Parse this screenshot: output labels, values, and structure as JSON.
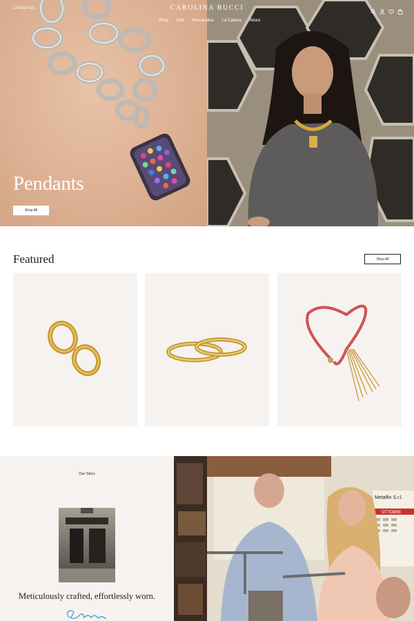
{
  "header": {
    "contact_label": "Contact Us",
    "brand": "CAROLINA BUCCI",
    "nav": [
      "Shop",
      "Edit",
      "Personalise",
      "La Catena",
      "About"
    ],
    "utility_icons": [
      "search-icon",
      "account-icon",
      "wishlist-heart-icon",
      "bag-icon"
    ]
  },
  "hero": {
    "title": "Pendants",
    "button_label": "Shop All"
  },
  "featured": {
    "title": "Featured",
    "button_label": "Shop All",
    "products": [
      {
        "name": "gold pave hoop earrings"
      },
      {
        "name": "gold pave stacking rings"
      },
      {
        "name": "red beaded necklace with gold tassel"
      }
    ]
  },
  "story": {
    "label": "Our Story",
    "heading": "Meticulously crafted, effortlessly worn.",
    "calendar": {
      "brand": "Metalfin S.r.l.",
      "month": "OTTOBRE"
    }
  },
  "colors": {
    "hero_bg": "#ddb194",
    "card_bg": "#f6f2ef",
    "text": "#1d1d1b",
    "signature": "#4aa3e0"
  }
}
